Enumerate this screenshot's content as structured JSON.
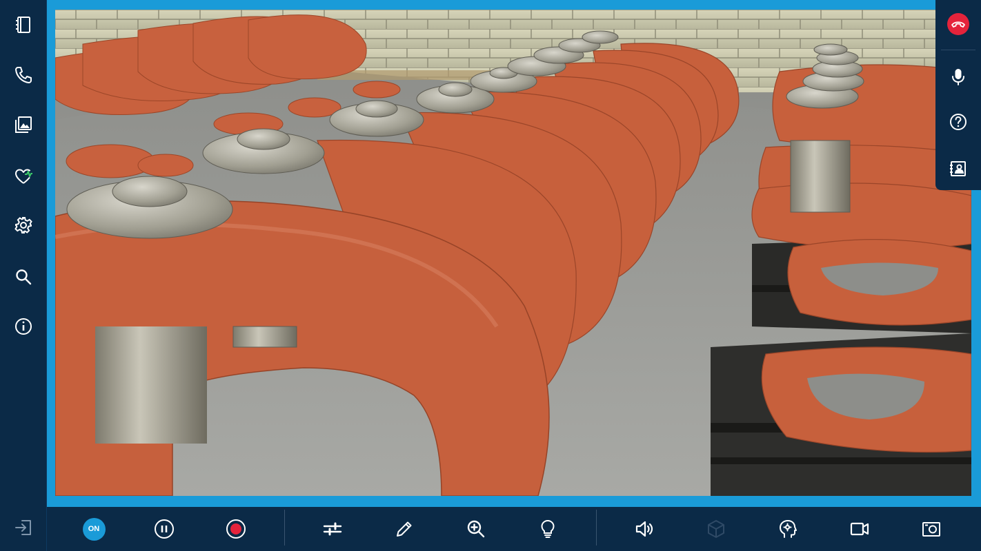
{
  "sidebar": {
    "items": [
      {
        "icon": "notebook-icon",
        "name": "sidebar-item-notes"
      },
      {
        "icon": "phone-icon",
        "name": "sidebar-item-call"
      },
      {
        "icon": "gallery-icon",
        "name": "sidebar-item-gallery"
      },
      {
        "icon": "heart-pulse-icon",
        "name": "sidebar-item-health"
      },
      {
        "icon": "gear-icon",
        "name": "sidebar-item-settings"
      },
      {
        "icon": "search-icon",
        "name": "sidebar-item-search"
      },
      {
        "icon": "info-icon",
        "name": "sidebar-item-info"
      }
    ],
    "exit_icon": "exit-icon"
  },
  "right_panel": {
    "items": [
      {
        "icon": "end-call-icon"
      },
      {
        "icon": "microphone-icon"
      },
      {
        "icon": "help-icon"
      },
      {
        "icon": "contact-card-icon"
      }
    ]
  },
  "toolbar": {
    "on_label": "ON",
    "items": [
      {
        "icon": "on-badge",
        "state": "on"
      },
      {
        "icon": "pause-icon"
      },
      {
        "icon": "record-icon",
        "color": "#e5233b"
      },
      {
        "icon": "sliders-icon"
      },
      {
        "icon": "pencil-icon"
      },
      {
        "icon": "zoom-in-icon"
      },
      {
        "icon": "lightbulb-icon"
      },
      {
        "icon": "speaker-icon"
      },
      {
        "icon": "cube-icon",
        "disabled": true
      },
      {
        "icon": "head-settings-icon"
      },
      {
        "icon": "video-camera-icon"
      },
      {
        "icon": "camera-snapshot-icon"
      }
    ]
  },
  "colors": {
    "background": "#0b2a47",
    "accent": "#1a9bd8",
    "danger": "#e5233b",
    "icon": "#ffffff",
    "disabled_icon": "#2f4a66"
  },
  "video": {
    "content": "live-camera-feed"
  }
}
